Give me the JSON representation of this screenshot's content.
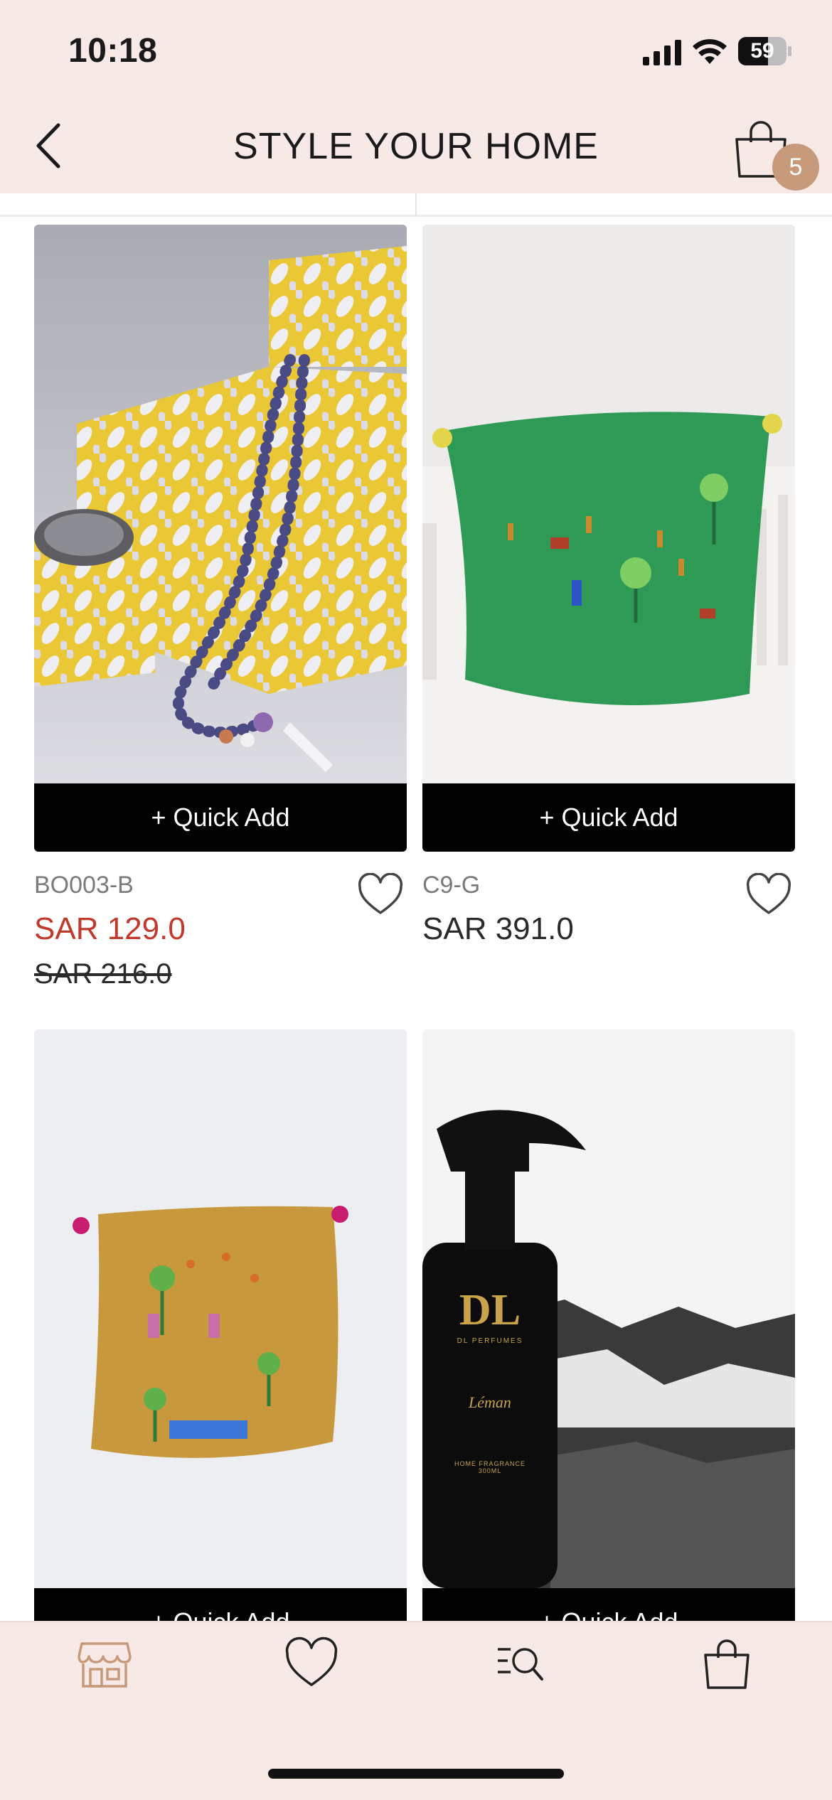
{
  "status_bar": {
    "time": "10:18",
    "battery": "59"
  },
  "header": {
    "title": "STYLE YOUR HOME",
    "cart_count": "5"
  },
  "products": [
    {
      "sku": "BO003-B",
      "price": "SAR 129.0",
      "old_price": "SAR 216.0",
      "on_sale": true,
      "quick_add": "+ Quick Add",
      "image": "yellow-mosaic-boxes-with-prayer-beads"
    },
    {
      "sku": "C9-G",
      "price": "SAR 391.0",
      "old_price": "",
      "on_sale": false,
      "quick_add": "+ Quick Add",
      "image": "green-embroidered-cushion"
    },
    {
      "sku": "",
      "price": "",
      "old_price": "",
      "quick_add": "+ Quick Add",
      "image": "mustard-embroidered-cushion"
    },
    {
      "sku": "",
      "price": "",
      "old_price": "",
      "quick_add": "+ Quick Add",
      "image": "dl-perfumes-leman-home-fragrance-spray"
    }
  ],
  "perfume_label": {
    "brand": "DL",
    "brand_sub": "DL PERFUMES",
    "name": "Léman",
    "type": "HOME FRAGRANCE",
    "size": "300ML"
  },
  "bottom_nav": [
    {
      "icon": "store-icon",
      "active": true
    },
    {
      "icon": "heart-icon",
      "active": false
    },
    {
      "icon": "search-list-icon",
      "active": false
    },
    {
      "icon": "bag-icon",
      "active": false
    }
  ],
  "colors": {
    "header_bg": "#f7e9e5",
    "accent": "#c79a7b",
    "sale": "#c0392b",
    "button_bg": "#000000"
  }
}
